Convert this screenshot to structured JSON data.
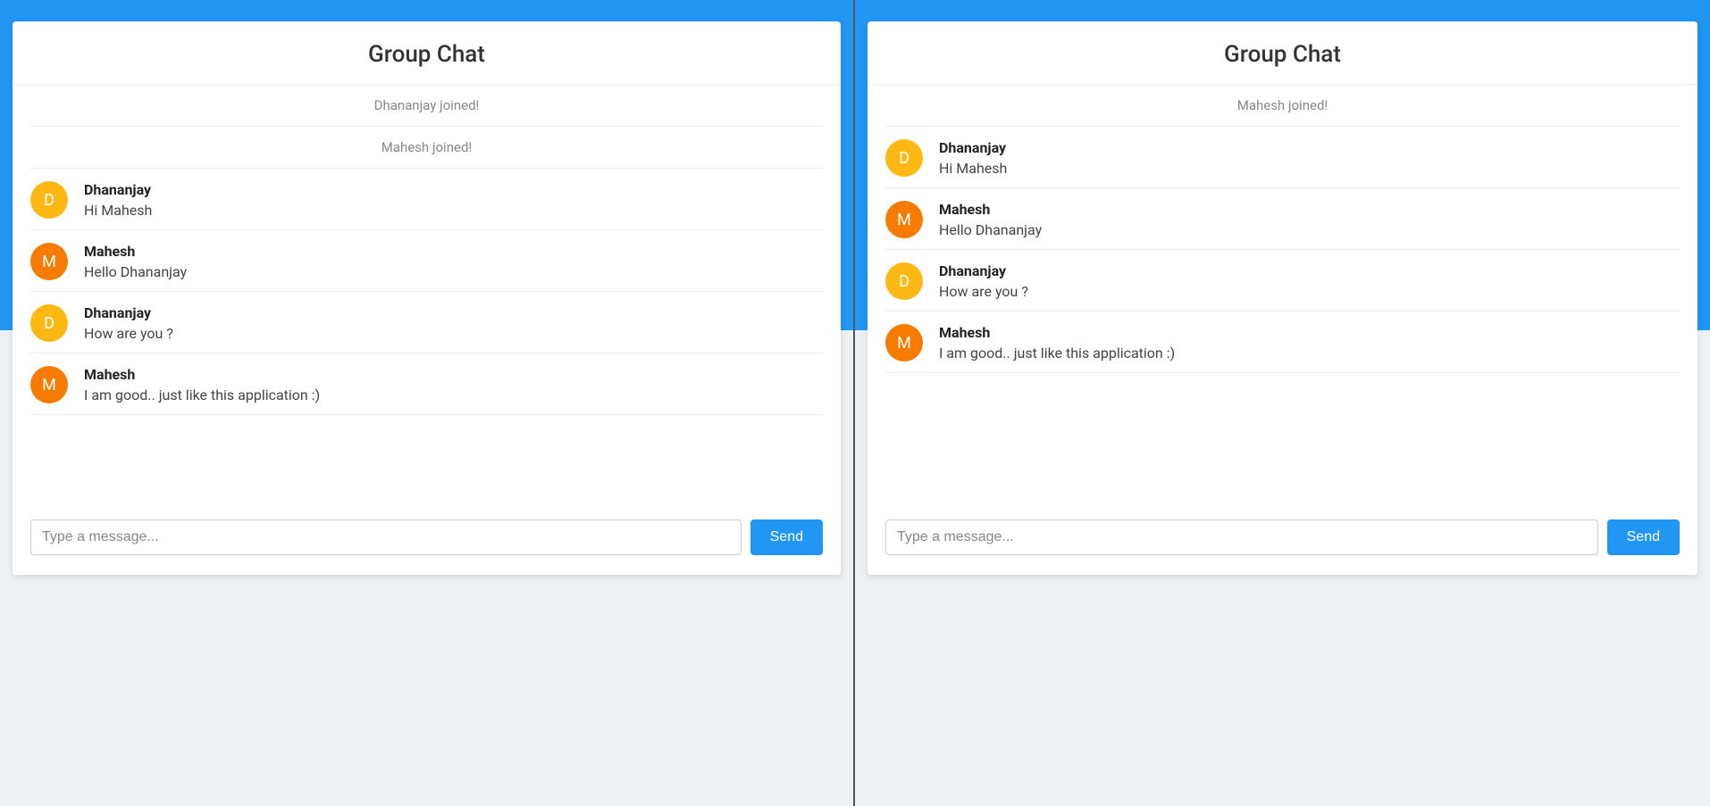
{
  "left": {
    "title": "Group Chat",
    "events": [
      {
        "kind": "system",
        "text": "Dhananjay joined!"
      },
      {
        "kind": "system",
        "text": "Mahesh joined!"
      },
      {
        "kind": "msg",
        "user": "Dhananjay",
        "initial": "D",
        "avatar": "d",
        "text": "Hi Mahesh"
      },
      {
        "kind": "msg",
        "user": "Mahesh",
        "initial": "M",
        "avatar": "m",
        "text": "Hello Dhananjay"
      },
      {
        "kind": "msg",
        "user": "Dhananjay",
        "initial": "D",
        "avatar": "d",
        "text": "How are you ?"
      },
      {
        "kind": "msg",
        "user": "Mahesh",
        "initial": "M",
        "avatar": "m",
        "text": "I am good.. just like this application :)"
      }
    ],
    "input_placeholder": "Type a message...",
    "send_label": "Send"
  },
  "right": {
    "title": "Group Chat",
    "events": [
      {
        "kind": "system",
        "text": "Mahesh joined!"
      },
      {
        "kind": "msg",
        "user": "Dhananjay",
        "initial": "D",
        "avatar": "d",
        "text": "Hi Mahesh"
      },
      {
        "kind": "msg",
        "user": "Mahesh",
        "initial": "M",
        "avatar": "m",
        "text": "Hello Dhananjay"
      },
      {
        "kind": "msg",
        "user": "Dhananjay",
        "initial": "D",
        "avatar": "d",
        "text": "How are you ?"
      },
      {
        "kind": "msg",
        "user": "Mahesh",
        "initial": "M",
        "avatar": "m",
        "text": "I am good.. just like this application :)"
      }
    ],
    "input_placeholder": "Type a message...",
    "send_label": "Send"
  }
}
